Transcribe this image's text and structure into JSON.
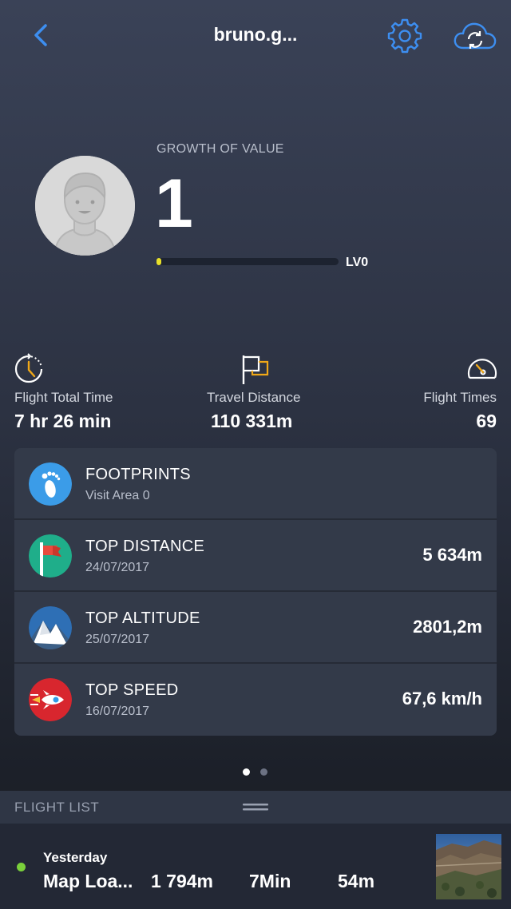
{
  "header": {
    "title": "bruno.g...",
    "back_icon": "chevron-left-icon",
    "settings_icon": "gear-icon",
    "sync_icon": "cloud-sync-icon",
    "accent_color": "#3d8ef0"
  },
  "profile": {
    "growth_label": "GROWTH OF VALUE",
    "growth_value": "1",
    "level": "LV0",
    "progress_fraction": 0.02
  },
  "stats": [
    {
      "icon": "stopwatch-icon",
      "label": "Flight Total Time",
      "value": "7 hr 26 min"
    },
    {
      "icon": "flag-icon",
      "label": "Travel Distance",
      "value": "110 331m"
    },
    {
      "icon": "speedometer-icon",
      "label": "Flight Times",
      "value": "69"
    }
  ],
  "records": [
    {
      "icon": "footprint-icon",
      "title": "FOOTPRINTS",
      "subtitle": "Visit Area 0",
      "value": ""
    },
    {
      "icon": "red-flag-icon",
      "title": "TOP DISTANCE",
      "subtitle": "24/07/2017",
      "value": "5 634m"
    },
    {
      "icon": "mountain-icon",
      "title": "TOP ALTITUDE",
      "subtitle": "25/07/2017",
      "value": "2801,2m"
    },
    {
      "icon": "rocket-icon",
      "title": "TOP SPEED",
      "subtitle": "16/07/2017",
      "value": "67,6 km/h"
    }
  ],
  "pager": {
    "pages": 2,
    "current": 1
  },
  "flight_list": {
    "label": "FLIGHT LIST",
    "items": [
      {
        "date": "Yesterday",
        "name": "Map Loa...",
        "distance": "1 794m",
        "duration": "7Min",
        "altitude": "54m",
        "status_color": "#7ad03b"
      }
    ]
  }
}
